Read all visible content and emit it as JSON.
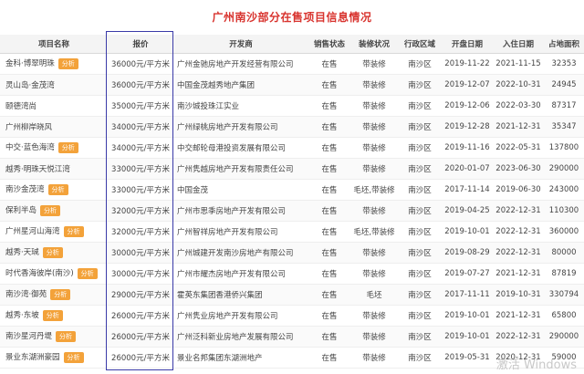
{
  "title": "广州南沙部分在售项目信息情况",
  "headers": [
    "项目名称",
    "报价",
    "开发商",
    "销售状态",
    "装修状况",
    "行政区域",
    "开盘日期",
    "入住日期",
    "占地面积"
  ],
  "badge_label": "分析",
  "rows": [
    {
      "name": "金科·博翠明珠",
      "badge": true,
      "price": "36000元/平方米",
      "developer": "广州金驰房地产开发经营有限公司",
      "status": "在售",
      "decoration": "带装修",
      "district": "南沙区",
      "open": "2019-11-22",
      "move_in": "2021-11-15",
      "area": "32353"
    },
    {
      "name": "灵山岛·金茂湾",
      "badge": false,
      "price": "36000元/平方米",
      "developer": "中国金茂越秀地产集团",
      "status": "在售",
      "decoration": "带装修",
      "district": "南沙区",
      "open": "2019-12-07",
      "move_in": "2022-10-31",
      "area": "24945"
    },
    {
      "name": "颐德湾尚",
      "badge": false,
      "price": "35000元/平方米",
      "developer": "南沙城投珠江实业",
      "status": "在售",
      "decoration": "带装修",
      "district": "南沙区",
      "open": "2019-12-06",
      "move_in": "2022-03-30",
      "area": "87317"
    },
    {
      "name": "广州柳岸晓风",
      "badge": false,
      "price": "34000元/平方米",
      "developer": "广州绿桃房地产开发有限公司",
      "status": "在售",
      "decoration": "带装修",
      "district": "南沙区",
      "open": "2019-12-28",
      "move_in": "2021-12-31",
      "area": "35347"
    },
    {
      "name": "中交·蓝色海湾",
      "badge": true,
      "price": "34000元/平方米",
      "developer": "中交邮轮母港投资发展有限公司",
      "status": "在售",
      "decoration": "带装修",
      "district": "南沙区",
      "open": "2019-11-16",
      "move_in": "2022-05-31",
      "area": "137800"
    },
    {
      "name": "越秀·明珠天悦江湾",
      "badge": false,
      "price": "33000元/平方米",
      "developer": "广州隽越房地产开发有限责任公司",
      "status": "在售",
      "decoration": "带装修",
      "district": "南沙区",
      "open": "2020-01-07",
      "move_in": "2023-06-30",
      "area": "290000"
    },
    {
      "name": "南沙金茂湾",
      "badge": true,
      "price": "33000元/平方米",
      "developer": "中国金茂",
      "status": "在售",
      "decoration": "毛坯,带装修",
      "district": "南沙区",
      "open": "2017-11-14",
      "move_in": "2019-06-30",
      "area": "243000"
    },
    {
      "name": "保利半岛",
      "badge": true,
      "price": "32000元/平方米",
      "developer": "广州市思季房地产开发有限公司",
      "status": "在售",
      "decoration": "带装修",
      "district": "南沙区",
      "open": "2019-04-25",
      "move_in": "2022-12-31",
      "area": "110300"
    },
    {
      "name": "广州星河山海湾",
      "badge": true,
      "price": "32000元/平方米",
      "developer": "广州智祥房地产开发有限公司",
      "status": "在售",
      "decoration": "毛坯,带装修",
      "district": "南沙区",
      "open": "2019-10-01",
      "move_in": "2022-12-31",
      "area": "360000"
    },
    {
      "name": "越秀·天珹",
      "badge": true,
      "price": "30000元/平方米",
      "developer": "广州城建开发南沙房地产有限公司",
      "status": "在售",
      "decoration": "带装修",
      "district": "南沙区",
      "open": "2019-08-29",
      "move_in": "2022-12-31",
      "area": "80000"
    },
    {
      "name": "时代香海彼岸(南沙)",
      "badge": true,
      "price": "30000元/平方米",
      "developer": "广州市耀杰房地产开发有限公司",
      "status": "在售",
      "decoration": "带装修",
      "district": "南沙区",
      "open": "2019-07-27",
      "move_in": "2021-12-31",
      "area": "87819"
    },
    {
      "name": "南沙湾·御苑",
      "badge": true,
      "price": "29000元/平方米",
      "developer": "霍英东集团香港侨兴集团",
      "status": "在售",
      "decoration": "毛坯",
      "district": "南沙区",
      "open": "2017-11-11",
      "move_in": "2019-10-31",
      "area": "330794"
    },
    {
      "name": "越秀·东坡",
      "badge": true,
      "price": "26000元/平方米",
      "developer": "广州隽业房地产开发有限公司",
      "status": "在售",
      "decoration": "带装修",
      "district": "南沙区",
      "open": "2019-10-01",
      "move_in": "2021-12-31",
      "area": "65800"
    },
    {
      "name": "南沙星河丹堤",
      "badge": true,
      "price": "26000元/平方米",
      "developer": "广州泛科新业房地产发展有限公司",
      "status": "在售",
      "decoration": "带装修",
      "district": "南沙区",
      "open": "2019-10-01",
      "move_in": "2022-12-31",
      "area": "290000"
    },
    {
      "name": "景业东湖洲豪园",
      "badge": true,
      "price": "26000元/平方米",
      "developer": "景业名邦集团东湖洲地产",
      "status": "在售",
      "decoration": "带装修",
      "district": "南沙区",
      "open": "2019-05-31",
      "move_in": "2020-12-31",
      "area": "59000"
    }
  ],
  "watermark": "激活 Windows",
  "colors": {
    "title": "#d8332e",
    "badge": "#f3a23a",
    "price_box": "#3a3aa8"
  }
}
